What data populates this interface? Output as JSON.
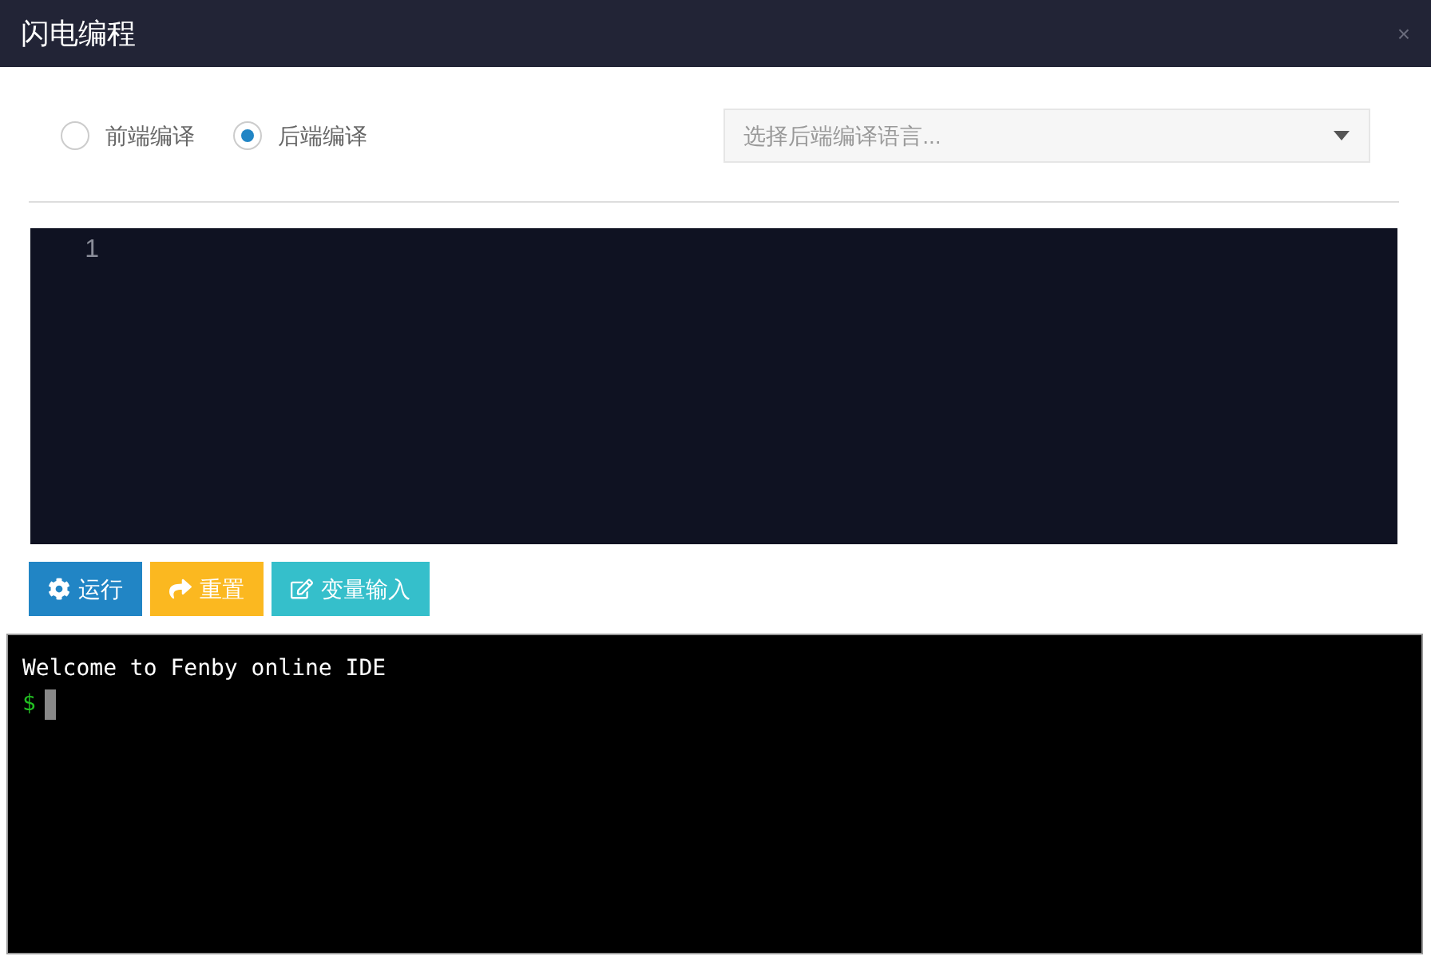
{
  "window": {
    "title": "闪电编程",
    "close": "×"
  },
  "compile_modes": [
    {
      "label": "前端编译",
      "selected": false
    },
    {
      "label": "后端编译",
      "selected": true
    }
  ],
  "language_select": {
    "placeholder": "选择后端编译语言..."
  },
  "editor": {
    "line_numbers": [
      "1"
    ]
  },
  "buttons": [
    {
      "kind": "run",
      "label": "运行"
    },
    {
      "kind": "reset",
      "label": "重置"
    },
    {
      "kind": "input",
      "label": "变量输入"
    }
  ],
  "terminal": {
    "lines": [
      "Welcome to Fenby online IDE"
    ],
    "prompt": "$"
  }
}
